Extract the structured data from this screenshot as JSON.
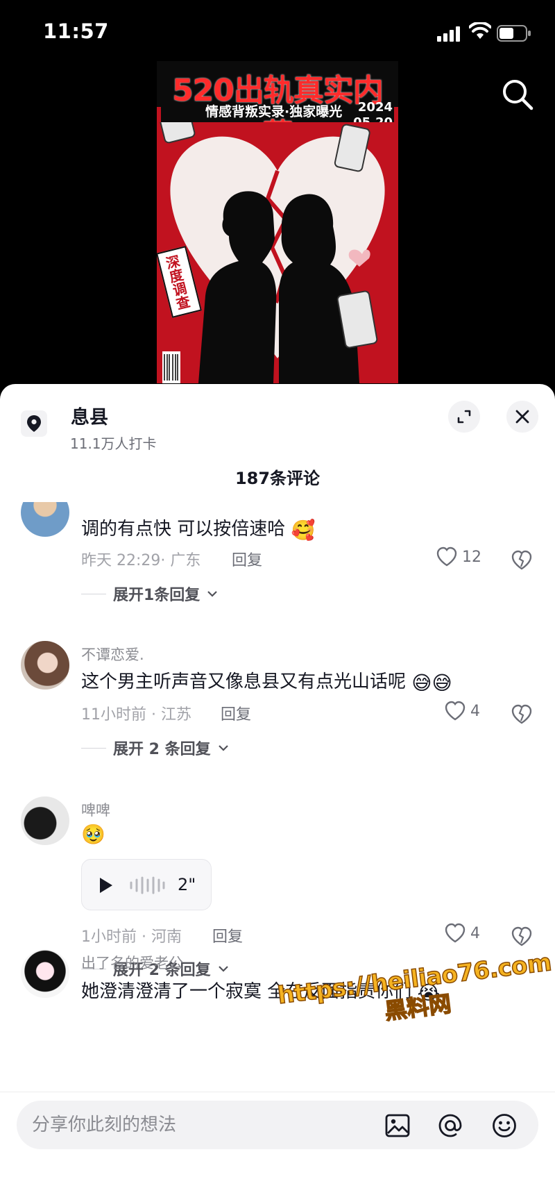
{
  "status_bar": {
    "time": "11:57"
  },
  "poster": {
    "title": "520出轨真实内幕",
    "subtitle": "情感背叛实录·独家曝光",
    "date_year": "2024",
    "date_day": "05.20",
    "tag": "深度调查"
  },
  "location": {
    "name": "息县",
    "checkins": "11.1万人打卡"
  },
  "comment_count": "187条评论",
  "comments": [
    {
      "user": "",
      "text": "调的有点快 可以按倍速哈",
      "emoji": "🥰",
      "time_place": "昨天 22:29· 广东",
      "reply": "回复",
      "likes": "12",
      "expand": "展开1条回复"
    },
    {
      "user": "不谭恋爱.",
      "text": "这个男主听声音又像息县又有点光山话呢",
      "emoji": "😅😅",
      "time_place": "11小时前 · 江苏",
      "reply": "回复",
      "likes": "4",
      "expand": "展开 2 条回复"
    },
    {
      "user": "啤啤",
      "text": "",
      "emoji": "🥹",
      "voice_duration": "2\"",
      "time_place": "1小时前 · 河南",
      "reply": "回复",
      "likes": "4",
      "expand": "展开 2 条回复"
    },
    {
      "user": "出了名的爱老公",
      "text": "她澄清澄清了一个寂寞 全在反面指责你们",
      "emoji": "😭"
    }
  ],
  "watermark": {
    "url": "https://heiliao76.com",
    "name": "黑料网"
  },
  "input": {
    "placeholder": "分享你此刻的想法"
  },
  "colors": {
    "poster_red": "#c1121f",
    "watermark": "#f5b321"
  }
}
